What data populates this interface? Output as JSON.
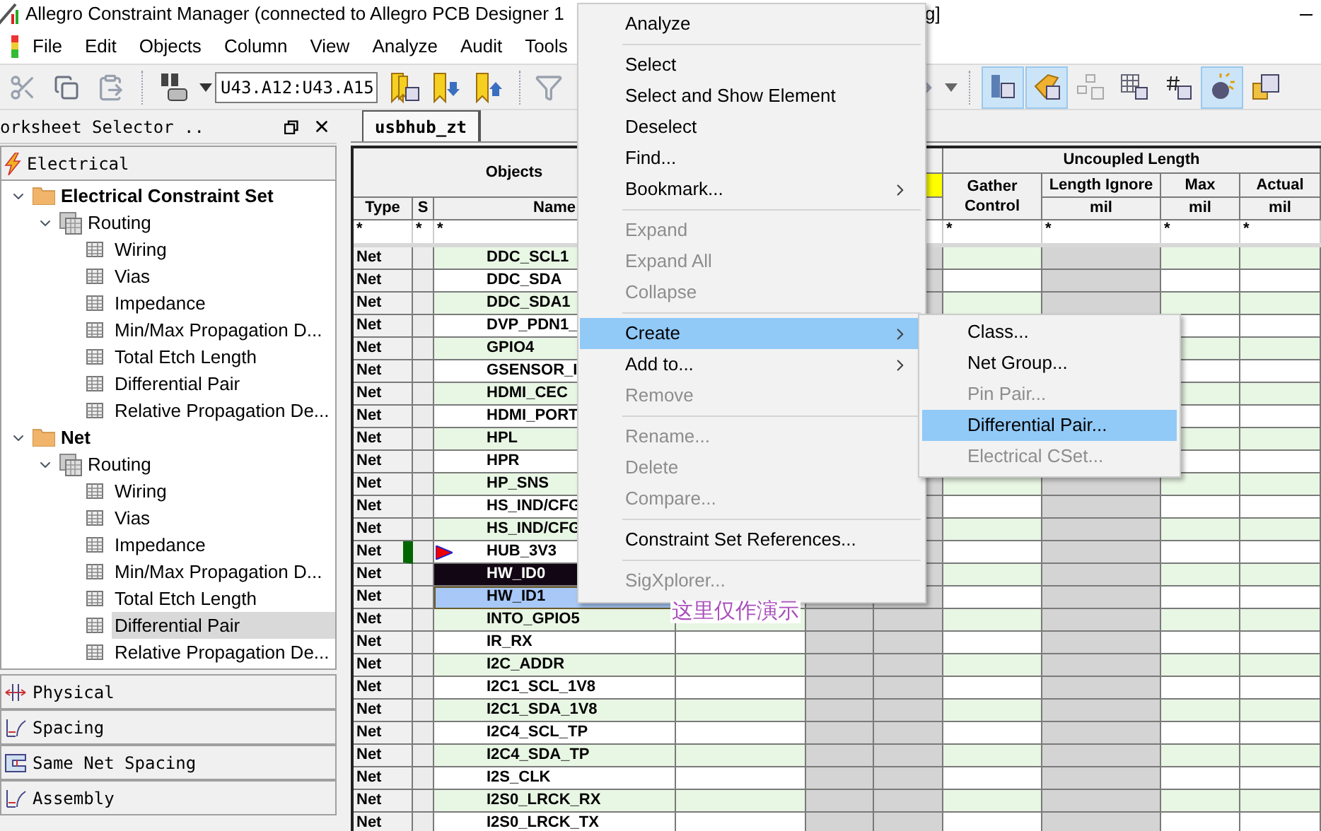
{
  "window": {
    "title": "Allegro Constraint Manager (connected to Allegro PCB Designer 1",
    "title_tail": "g]"
  },
  "menu_bar": [
    "File",
    "Edit",
    "Objects",
    "Column",
    "View",
    "Analyze",
    "Audit",
    "Tools"
  ],
  "toolbar": {
    "net_selector": "U43.A12:U43.A15",
    "right_tools": [
      {
        "pressed": true
      },
      {
        "pressed": true
      },
      {
        "pressed": false
      },
      {
        "pressed": false
      },
      {
        "pressed": false
      },
      {
        "pressed": true
      },
      {
        "pressed": false
      }
    ]
  },
  "worksheet_selector": {
    "title": "orksheet Selector ..",
    "top_section": "Electrical",
    "tree": [
      {
        "label": "Electrical Constraint Set",
        "kind": "folder",
        "expanded": true,
        "selected": false,
        "children": [
          {
            "label": "Routing",
            "kind": "stack",
            "expanded": true,
            "selected": false,
            "children": [
              {
                "label": "Wiring",
                "kind": "sheet",
                "selected": false
              },
              {
                "label": "Vias",
                "kind": "sheet",
                "selected": false
              },
              {
                "label": "Impedance",
                "kind": "sheet",
                "selected": false
              },
              {
                "label": "Min/Max Propagation D...",
                "kind": "sheet",
                "selected": false
              },
              {
                "label": "Total Etch Length",
                "kind": "sheet",
                "selected": false
              },
              {
                "label": "Differential Pair",
                "kind": "sheet",
                "selected": false
              },
              {
                "label": "Relative Propagation De...",
                "kind": "sheet",
                "selected": false
              }
            ]
          }
        ]
      },
      {
        "label": "Net",
        "kind": "folder",
        "expanded": true,
        "selected": false,
        "children": [
          {
            "label": "Routing",
            "kind": "stack",
            "expanded": true,
            "selected": false,
            "children": [
              {
                "label": "Wiring",
                "kind": "sheet",
                "selected": false
              },
              {
                "label": "Vias",
                "kind": "sheet",
                "selected": false
              },
              {
                "label": "Impedance",
                "kind": "sheet",
                "selected": false
              },
              {
                "label": "Min/Max Propagation D...",
                "kind": "sheet",
                "selected": false
              },
              {
                "label": "Total Etch Length",
                "kind": "sheet",
                "selected": false
              },
              {
                "label": "Differential Pair",
                "kind": "sheet",
                "selected": true
              },
              {
                "label": "Relative Propagation De...",
                "kind": "sheet",
                "selected": false
              }
            ]
          }
        ]
      }
    ],
    "sections": [
      {
        "label": "Physical",
        "kind": "physical"
      },
      {
        "label": "Spacing",
        "kind": "spacing"
      },
      {
        "label": "Same Net Spacing",
        "kind": "samenet"
      },
      {
        "label": "Assembly",
        "kind": "spacing"
      }
    ]
  },
  "tab": {
    "label": "usbhub_zt"
  },
  "table": {
    "group_headers": {
      "objects": "Objects",
      "uncoupled": "Uncoupled Length"
    },
    "columns": {
      "type": "Type",
      "s": "S",
      "name": "Name",
      "gather": "Gather Control",
      "length_ignore": "Length Ignore",
      "max": "Max",
      "actual": "Actual"
    },
    "units": [
      "mil",
      "mil",
      "mil"
    ],
    "filters": {
      "type": "*",
      "s": "*",
      "name": "*",
      "gather": "*",
      "length_ignore": "*",
      "max": "*",
      "actual": "*"
    },
    "rows": [
      {
        "type": "Net",
        "name": "DDC_SCL1",
        "flagged": false,
        "selected": false,
        "current": false
      },
      {
        "type": "Net",
        "name": "DDC_SDA",
        "flagged": false,
        "selected": false,
        "current": false
      },
      {
        "type": "Net",
        "name": "DDC_SDA1",
        "flagged": false,
        "selected": false,
        "current": false
      },
      {
        "type": "Net",
        "name": "DVP_PDN1_",
        "flagged": false,
        "selected": false,
        "current": false
      },
      {
        "type": "Net",
        "name": "GPIO4",
        "flagged": false,
        "selected": false,
        "current": false
      },
      {
        "type": "Net",
        "name": "GSENSOR_I",
        "flagged": false,
        "selected": false,
        "current": false
      },
      {
        "type": "Net",
        "name": "HDMI_CEC",
        "flagged": false,
        "selected": false,
        "current": false
      },
      {
        "type": "Net",
        "name": "HDMI_PORT",
        "flagged": false,
        "selected": false,
        "current": false
      },
      {
        "type": "Net",
        "name": "HPL",
        "flagged": false,
        "selected": false,
        "current": false
      },
      {
        "type": "Net",
        "name": "HPR",
        "flagged": false,
        "selected": false,
        "current": false
      },
      {
        "type": "Net",
        "name": "HP_SNS",
        "flagged": false,
        "selected": false,
        "current": false
      },
      {
        "type": "Net",
        "name": "HS_IND/CFG",
        "flagged": false,
        "selected": false,
        "current": false
      },
      {
        "type": "Net",
        "name": "HS_IND/CFG",
        "flagged": false,
        "selected": false,
        "current": false
      },
      {
        "type": "Net",
        "name": "HUB_3V3",
        "flagged": true,
        "selected": false,
        "current": false
      },
      {
        "type": "Net",
        "name": "HW_ID0",
        "flagged": false,
        "selected": true,
        "current": false
      },
      {
        "type": "Net",
        "name": "HW_ID1",
        "flagged": false,
        "selected": true,
        "current": true
      },
      {
        "type": "Net",
        "name": "INTO_GPIO5",
        "flagged": false,
        "selected": false,
        "current": false
      },
      {
        "type": "Net",
        "name": "IR_RX",
        "flagged": false,
        "selected": false,
        "current": false
      },
      {
        "type": "Net",
        "name": "I2C_ADDR",
        "flagged": false,
        "selected": false,
        "current": false
      },
      {
        "type": "Net",
        "name": "I2C1_SCL_1V8",
        "flagged": false,
        "selected": false,
        "current": false
      },
      {
        "type": "Net",
        "name": "I2C1_SDA_1V8",
        "flagged": false,
        "selected": false,
        "current": false
      },
      {
        "type": "Net",
        "name": "I2C4_SCL_TP",
        "flagged": false,
        "selected": false,
        "current": false
      },
      {
        "type": "Net",
        "name": "I2C4_SDA_TP",
        "flagged": false,
        "selected": false,
        "current": false
      },
      {
        "type": "Net",
        "name": "I2S_CLK",
        "flagged": false,
        "selected": false,
        "current": false
      },
      {
        "type": "Net",
        "name": "I2S0_LRCK_RX",
        "flagged": false,
        "selected": false,
        "current": false
      },
      {
        "type": "Net",
        "name": "I2S0_LRCK_TX",
        "flagged": false,
        "selected": false,
        "current": false
      }
    ]
  },
  "annotation": "这里仅作演示",
  "context_menu": [
    {
      "kind": "item",
      "label": "Analyze",
      "disabled": false,
      "selected": false,
      "submenu": false
    },
    {
      "kind": "separator"
    },
    {
      "kind": "item",
      "label": "Select",
      "disabled": false,
      "selected": false,
      "submenu": false
    },
    {
      "kind": "item",
      "label": "Select and Show Element",
      "disabled": false,
      "selected": false,
      "submenu": false
    },
    {
      "kind": "item",
      "label": "Deselect",
      "disabled": false,
      "selected": false,
      "submenu": false
    },
    {
      "kind": "item",
      "label": "Find...",
      "disabled": false,
      "selected": false,
      "submenu": false
    },
    {
      "kind": "item",
      "label": "Bookmark...",
      "disabled": false,
      "selected": false,
      "submenu": true
    },
    {
      "kind": "separator"
    },
    {
      "kind": "item",
      "label": "Expand",
      "disabled": true,
      "selected": false,
      "submenu": false
    },
    {
      "kind": "item",
      "label": "Expand All",
      "disabled": true,
      "selected": false,
      "submenu": false
    },
    {
      "kind": "item",
      "label": "Collapse",
      "disabled": true,
      "selected": false,
      "submenu": false
    },
    {
      "kind": "separator"
    },
    {
      "kind": "item",
      "label": "Create",
      "disabled": false,
      "selected": true,
      "submenu": true
    },
    {
      "kind": "item",
      "label": "Add to...",
      "disabled": false,
      "selected": false,
      "submenu": true
    },
    {
      "kind": "item",
      "label": "Remove",
      "disabled": true,
      "selected": false,
      "submenu": false
    },
    {
      "kind": "separator"
    },
    {
      "kind": "item",
      "label": "Rename...",
      "disabled": true,
      "selected": false,
      "submenu": false
    },
    {
      "kind": "item",
      "label": "Delete",
      "disabled": true,
      "selected": false,
      "submenu": false
    },
    {
      "kind": "item",
      "label": "Compare...",
      "disabled": true,
      "selected": false,
      "submenu": false
    },
    {
      "kind": "separator"
    },
    {
      "kind": "item",
      "label": "Constraint Set References...",
      "disabled": false,
      "selected": false,
      "submenu": false
    },
    {
      "kind": "separator"
    },
    {
      "kind": "item",
      "label": "SigXplorer...",
      "disabled": true,
      "selected": false,
      "submenu": false
    }
  ],
  "submenu": [
    {
      "label": "Class...",
      "disabled": false,
      "selected": false
    },
    {
      "label": "Net Group...",
      "disabled": false,
      "selected": false
    },
    {
      "label": "Pin Pair...",
      "disabled": true,
      "selected": false
    },
    {
      "label": "Differential Pair...",
      "disabled": false,
      "selected": true
    },
    {
      "label": "Electrical CSet...",
      "disabled": true,
      "selected": false
    }
  ]
}
